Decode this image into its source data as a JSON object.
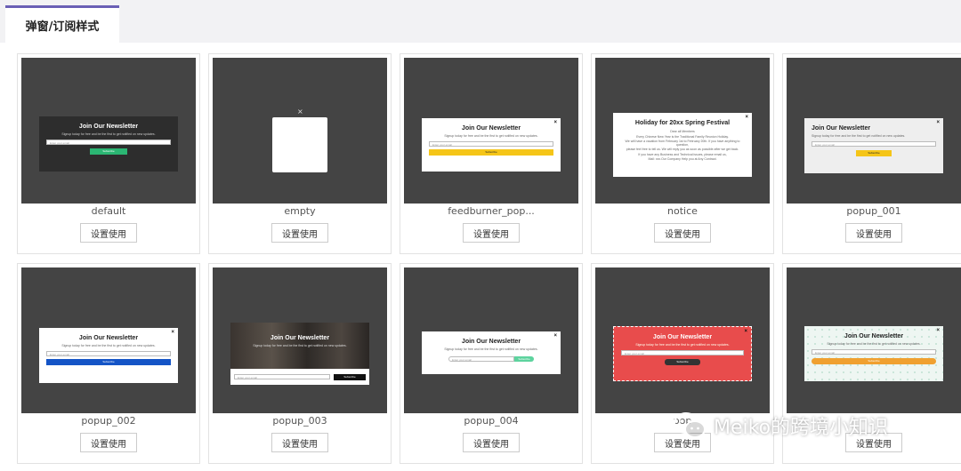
{
  "tab": {
    "label": "弹窗/订阅样式"
  },
  "button_label": "设置使用",
  "cards": [
    {
      "name": "default",
      "popup": {
        "title": "Join Our Newsletter",
        "sub": "Signup today for free and be the first to get notified on new updates.",
        "input": "Enter your email",
        "button": "Subscribe"
      }
    },
    {
      "name": "empty",
      "popup": {
        "close": "×"
      }
    },
    {
      "name": "feedburner_pop...",
      "popup": {
        "title": "Join Our Newsletter",
        "sub": "Signup today for free and be the first to get notified on new updates.",
        "input": "Enter your email",
        "button": "Subscribe",
        "close": "×"
      }
    },
    {
      "name": "notice",
      "popup": {
        "title": "Holiday for 20xx Spring Festival",
        "sub1": "Dear all Members",
        "sub2": "Every Chinese New Year is the Traditional Family Reunion Holiday.",
        "sub3": "We will have a vacation from February 1st to February 20th. If you have anything to question,",
        "sub4": "please feel free to tell us. We will reply you as soon as possible after we get back.",
        "sub5": "If you have any Business and Technical issues, please email us,",
        "sub6": "Mail: xxx.Our Company Help you at Any Contract.",
        "close": "×"
      }
    },
    {
      "name": "popup_001",
      "popup": {
        "title": "Join Our Newsletter",
        "sub": "Signup today for free and be the first to get notified on new updates.",
        "input": "Enter your email",
        "button": "Subscribe",
        "close": "×"
      }
    },
    {
      "name": "popup_002",
      "popup": {
        "title": "Join Our Newsletter",
        "sub": "Signup today for free and be the first to get notified on new updates.",
        "input": "Enter your email",
        "button": "Subscribe",
        "close": "×"
      }
    },
    {
      "name": "popup_003",
      "popup": {
        "title": "Join Our Newsletter",
        "sub": "Signup today for free and be the first to get notified on new updates.",
        "input": "Enter your email",
        "button": "Subscribe"
      }
    },
    {
      "name": "popup_004",
      "popup": {
        "title": "Join Our Newsletter",
        "sub": "Signup today for free and be the first to get notified on new updates.",
        "input": "Enter your email",
        "button": "Subscribe",
        "close": "×"
      }
    },
    {
      "name": "pop",
      "popup": {
        "title": "Join Our Newsletter",
        "sub": "Signup today for free and be the first to get notified on new updates.",
        "input": "Enter your email",
        "button": "Subscribe",
        "close": "×"
      }
    },
    {
      "name": "",
      "popup": {
        "title": "Join Our Newsletter",
        "sub": "Signup today for free and be the first to get notified on new updates.",
        "input": "Enter your email",
        "button": "Subscribe",
        "close": "×"
      }
    }
  ],
  "watermark": {
    "text": "Meiko的跨境小知识"
  },
  "colors": {
    "tab_accent": "#6a5fb5",
    "thumb_bg": "#444444",
    "green": "#2bb673",
    "yellow": "#f5c518",
    "blue": "#1454c6",
    "mint": "#5dd39e",
    "red": "#e84c4c",
    "orange": "#f0a030"
  }
}
